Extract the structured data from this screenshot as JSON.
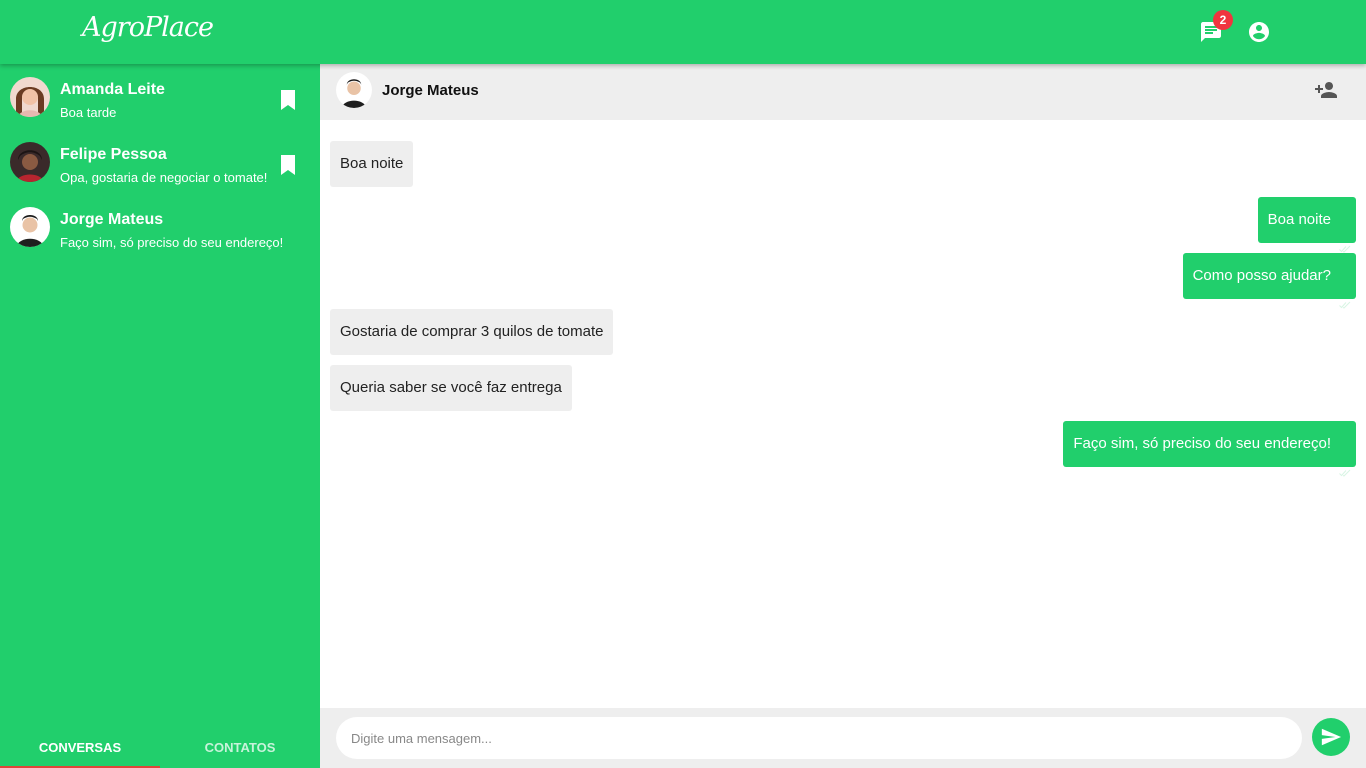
{
  "app": {
    "logo_text": "AgroPlace",
    "message_count": "2"
  },
  "conversations": [
    {
      "name": "Amanda Leite",
      "preview": "Boa tarde",
      "bookmarked": true
    },
    {
      "name": "Felipe Pessoa",
      "preview": "Opa, gostaria de negociar o tomate!",
      "bookmarked": true
    },
    {
      "name": "Jorge Mateus",
      "preview": "Faço sim, só preciso do seu endereço!",
      "bookmarked": false
    }
  ],
  "tabs": {
    "conversations": "CONVERSAS",
    "contacts": "CONTATOS",
    "active": "conversations"
  },
  "chat": {
    "contact_name": "Jorge Mateus",
    "messages": [
      {
        "direction": "in",
        "text": "Boa noite"
      },
      {
        "direction": "out",
        "text": "Boa noite"
      },
      {
        "direction": "out",
        "text": "Como posso ajudar?"
      },
      {
        "direction": "in",
        "text": "Gostaria de comprar 3 quilos de tomate"
      },
      {
        "direction": "in",
        "text": "Queria saber se você faz entrega"
      },
      {
        "direction": "out",
        "text": "Faço sim, só preciso do seu endereço!"
      }
    ]
  },
  "composer": {
    "placeholder": "Digite uma mensagem..."
  },
  "colors": {
    "brand_green": "#21cf6c",
    "badge_red": "#f0353f",
    "tab_indicator": "#e0453a",
    "panel_gray": "#eeeeee"
  },
  "icons": {
    "topbar": [
      "chat-icon",
      "account-icon"
    ],
    "conversation": "bookmark-icon",
    "header": "person-add-icon",
    "message_status": "double-check-icon",
    "send": "send-icon"
  }
}
